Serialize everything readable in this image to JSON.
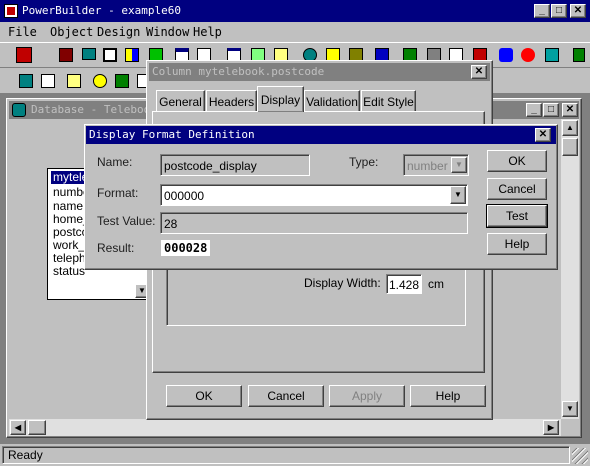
{
  "app": {
    "title": "PowerBuilder - example60",
    "status": "Ready"
  },
  "menu": [
    "File",
    "Object",
    "Design",
    "Window",
    "Help"
  ],
  "toolbar": {
    "row1": [
      "powerbar-icon",
      "open-icon",
      "library-icon",
      "dbpainter-icon",
      "table-icon",
      "application-icon",
      "window-icon",
      "datawindow-icon",
      "structure-icon",
      "function-icon",
      "query-icon",
      "pipeline-icon",
      "project-icon",
      "menu-icon",
      "user-object-icon",
      "browser-icon",
      "debug-icon",
      "run-icon",
      "exit-icon"
    ],
    "row2": [
      "table-list-icon",
      "column-list-icon",
      "grid-icon",
      "key-icon",
      "query-icon",
      "sql-icon"
    ]
  },
  "db_window": {
    "title": "Database - Telebook",
    "table_items": [
      "mytele",
      "numbe",
      "name",
      "home_",
      "postcc",
      "work_",
      "teleph",
      "status"
    ]
  },
  "column_dialog": {
    "title": "Column mytelebook.postcode",
    "tabs": [
      "General",
      "Headers",
      "Display",
      "Validation",
      "Edit Style"
    ],
    "active_tab": "Display",
    "display_width_label": "Display Width:",
    "display_width_value": "1.428",
    "display_width_unit": "cm",
    "buttons": {
      "ok": "OK",
      "cancel": "Cancel",
      "apply": "Apply",
      "help": "Help"
    }
  },
  "format_dialog": {
    "title": "Display Format Definition",
    "name_label": "Name:",
    "name_value": "postcode_display",
    "type_label": "Type:",
    "type_value": "number",
    "format_label": "Format:",
    "format_value": "000000",
    "test_value_label": "Test Value:",
    "test_value": "28",
    "result_label": "Result:",
    "result_value": "000028",
    "buttons": {
      "ok": "OK",
      "cancel": "Cancel",
      "test": "Test",
      "help": "Help"
    }
  }
}
